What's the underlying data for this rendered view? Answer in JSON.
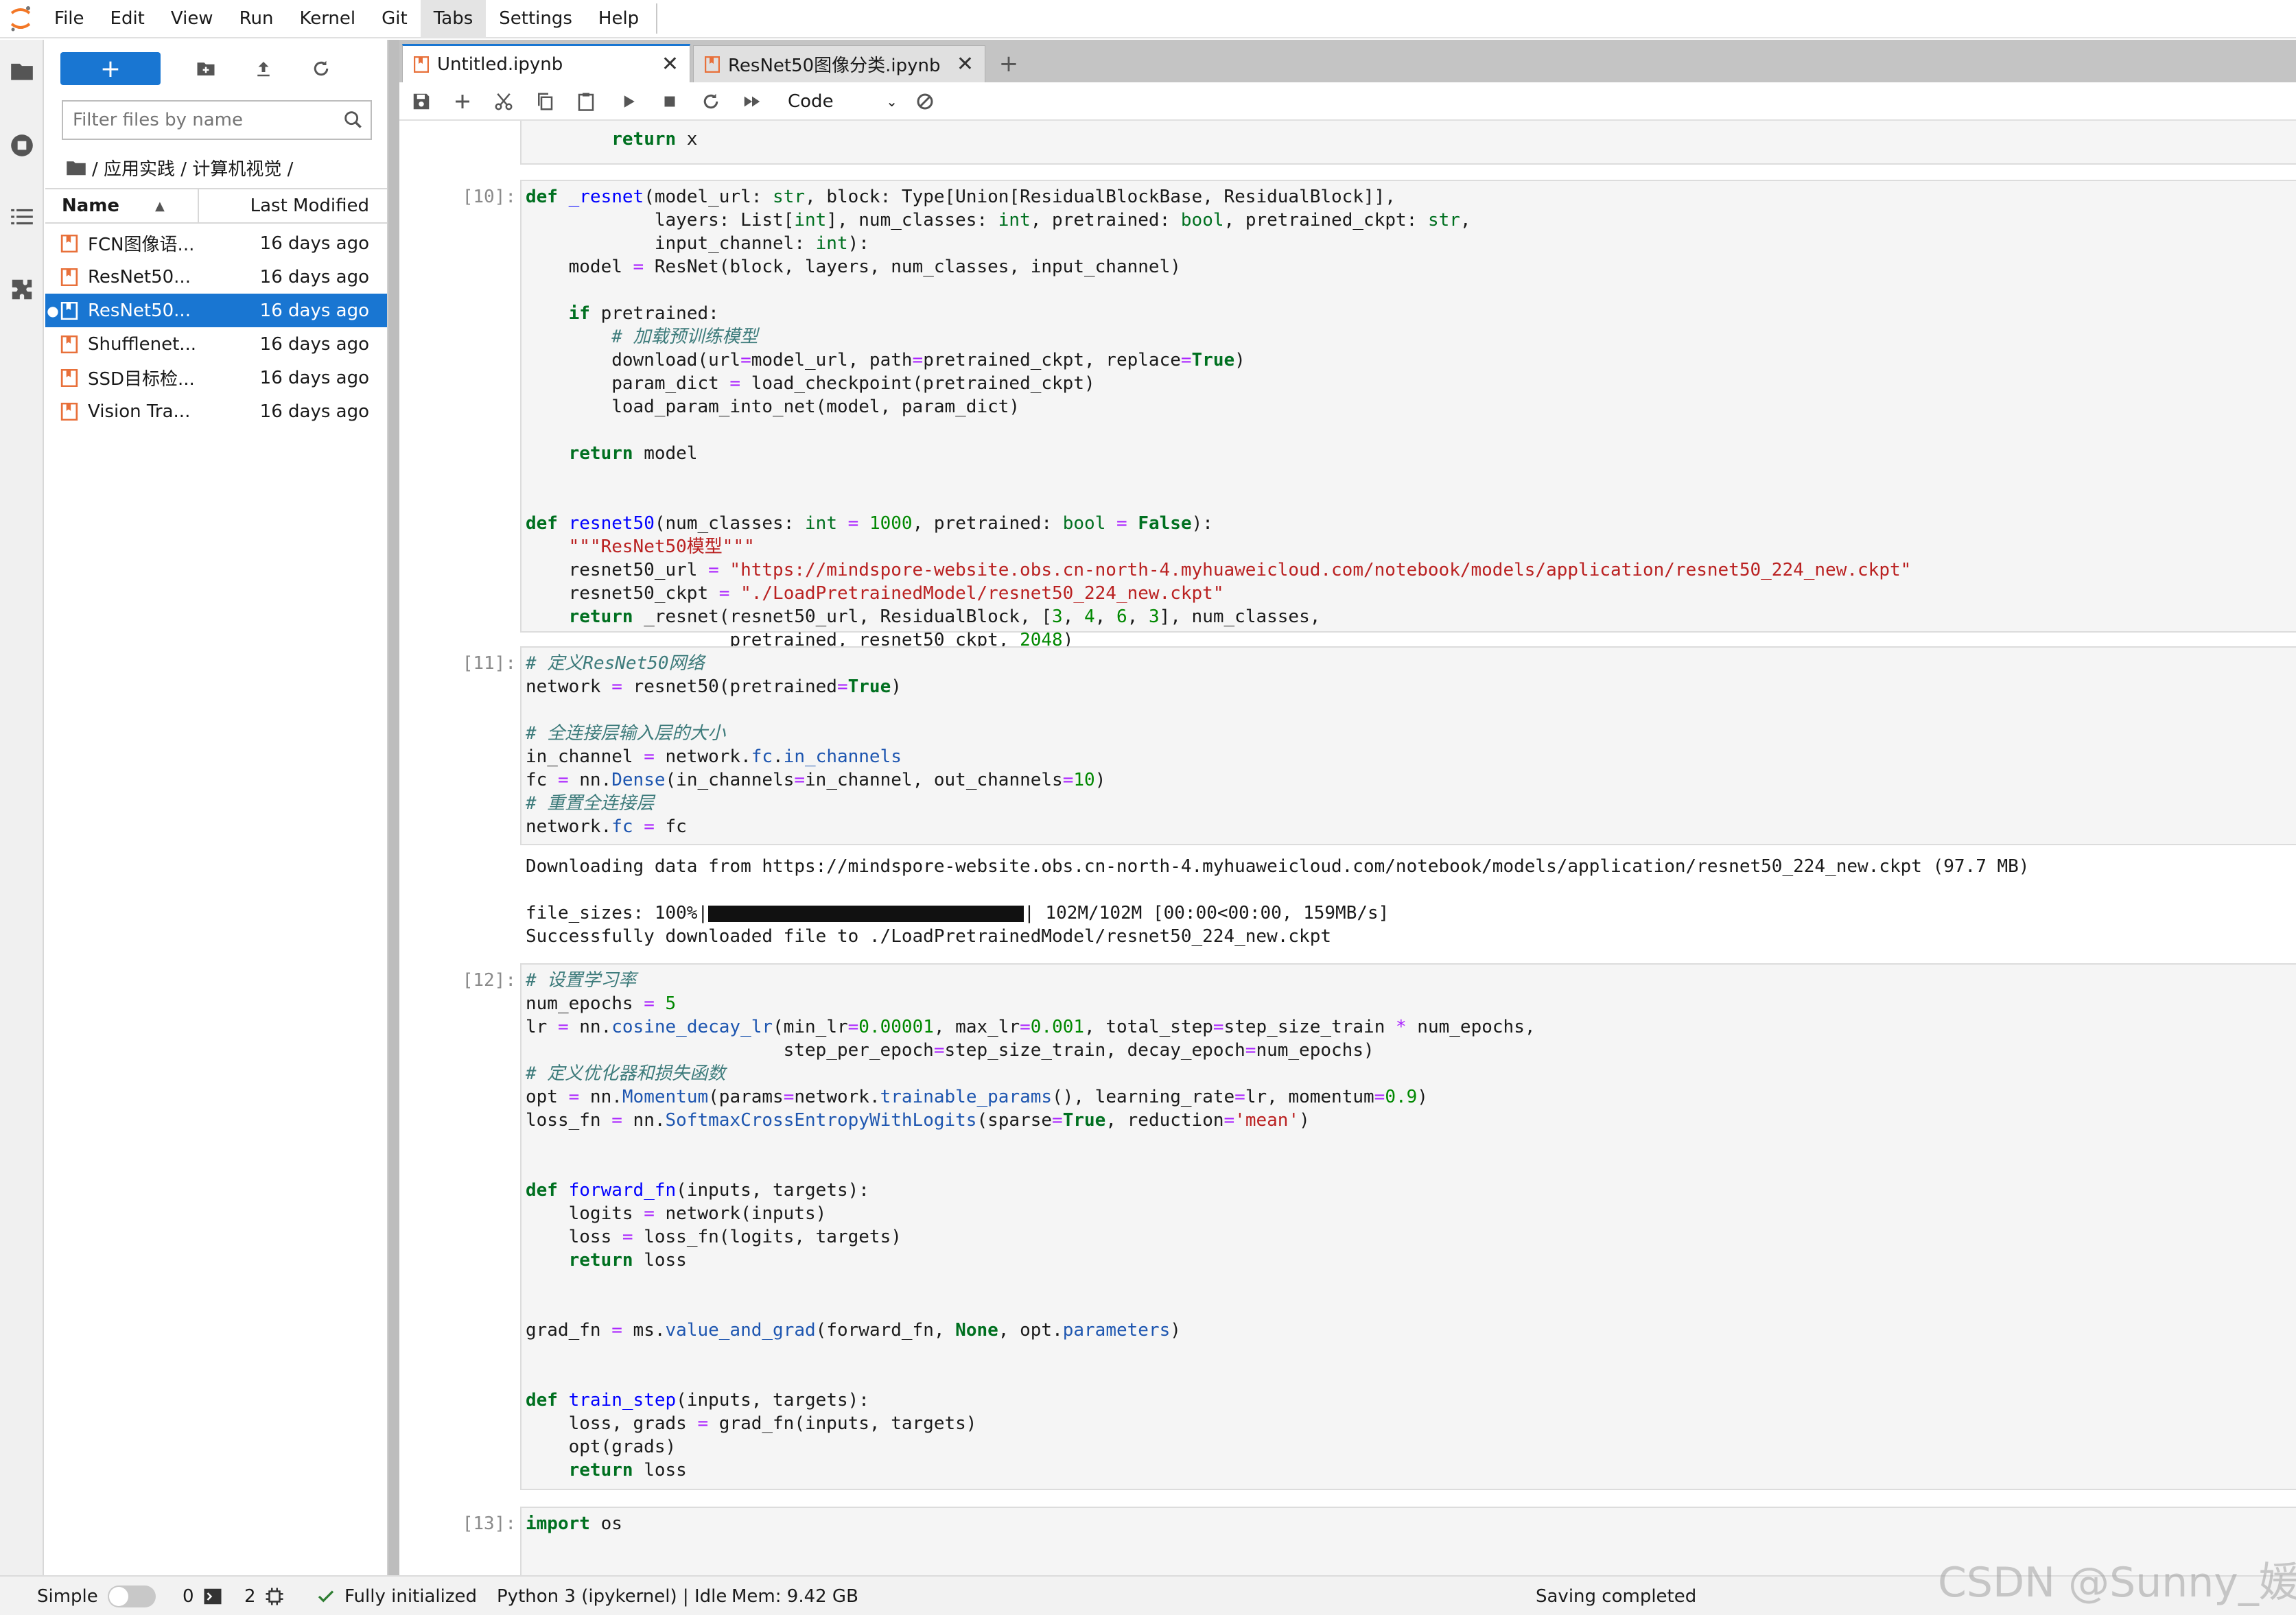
{
  "menu": [
    "File",
    "Edit",
    "View",
    "Run",
    "Kernel",
    "Git",
    "Tabs",
    "Settings",
    "Help"
  ],
  "active_menu": "Tabs",
  "filebrowser": {
    "new_label": "+",
    "filter_placeholder": "Filter files by name",
    "breadcrumb": "/ 应用实践 / 计算机视觉 /",
    "col_name": "Name",
    "col_modified": "Last Modified",
    "files": [
      {
        "name": "FCN图像语...",
        "modified": "16 days ago",
        "selected": false
      },
      {
        "name": "ResNet50...",
        "modified": "16 days ago",
        "selected": false
      },
      {
        "name": "ResNet50...",
        "modified": "16 days ago",
        "selected": true
      },
      {
        "name": "Shufflenet...",
        "modified": "16 days ago",
        "selected": false
      },
      {
        "name": "SSD目标检...",
        "modified": "16 days ago",
        "selected": false
      },
      {
        "name": "Vision Tra...",
        "modified": "16 days ago",
        "selected": false
      }
    ]
  },
  "tabs": [
    {
      "label": "Untitled.ipynb",
      "active": true
    },
    {
      "label": "ResNet50图像分类.ipynb",
      "active": false
    }
  ],
  "cell_type": "Code",
  "prompts": {
    "c10": "[10]:",
    "c11": "[11]:",
    "c12": "[12]:",
    "c13": "[13]:"
  },
  "outputs": {
    "download_line": "Downloading data from https://mindspore-website.obs.cn-north-4.myhuaweicloud.com/notebook/models/application/resnet50_224_new.ckpt (97.7 MB)",
    "progress_prefix": "file_sizes: 100%|",
    "progress_suffix": "| 102M/102M [00:00<00:00, 159MB/s]",
    "success_line": "Successfully downloaded file to ./LoadPretrainedModel/resnet50_224_new.ckpt"
  },
  "status": {
    "mode": "Simple",
    "terminals": "0",
    "kernels": "2",
    "init": "Fully initialized",
    "kernel": "Python 3 (ipykernel) | Idle",
    "mem": "Mem: 9.42 GB",
    "saving": "Saving completed"
  },
  "watermark": "CSDN @Sunny_媛",
  "colors": {
    "accent": "#1976d2",
    "notebook_icon": "#e8703a"
  }
}
